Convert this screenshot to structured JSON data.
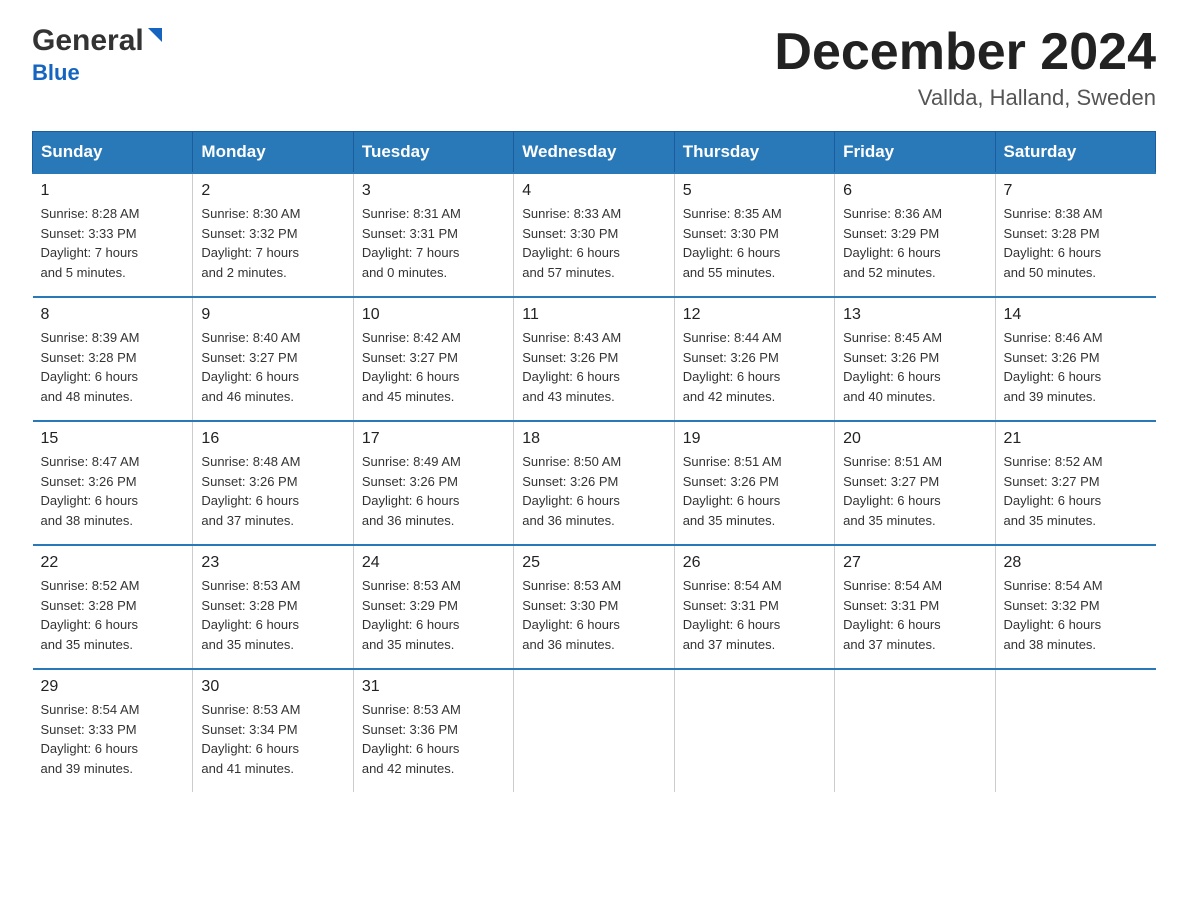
{
  "header": {
    "logo_general": "General",
    "logo_blue": "Blue",
    "month": "December 2024",
    "location": "Vallda, Halland, Sweden"
  },
  "days_of_week": [
    "Sunday",
    "Monday",
    "Tuesday",
    "Wednesday",
    "Thursday",
    "Friday",
    "Saturday"
  ],
  "weeks": [
    [
      {
        "num": "1",
        "sunrise": "8:28 AM",
        "sunset": "3:33 PM",
        "daylight_hours": "7",
        "daylight_minutes": "5"
      },
      {
        "num": "2",
        "sunrise": "8:30 AM",
        "sunset": "3:32 PM",
        "daylight_hours": "7",
        "daylight_minutes": "2"
      },
      {
        "num": "3",
        "sunrise": "8:31 AM",
        "sunset": "3:31 PM",
        "daylight_hours": "7",
        "daylight_minutes": "0"
      },
      {
        "num": "4",
        "sunrise": "8:33 AM",
        "sunset": "3:30 PM",
        "daylight_hours": "6",
        "daylight_minutes": "57"
      },
      {
        "num": "5",
        "sunrise": "8:35 AM",
        "sunset": "3:30 PM",
        "daylight_hours": "6",
        "daylight_minutes": "55"
      },
      {
        "num": "6",
        "sunrise": "8:36 AM",
        "sunset": "3:29 PM",
        "daylight_hours": "6",
        "daylight_minutes": "52"
      },
      {
        "num": "7",
        "sunrise": "8:38 AM",
        "sunset": "3:28 PM",
        "daylight_hours": "6",
        "daylight_minutes": "50"
      }
    ],
    [
      {
        "num": "8",
        "sunrise": "8:39 AM",
        "sunset": "3:28 PM",
        "daylight_hours": "6",
        "daylight_minutes": "48"
      },
      {
        "num": "9",
        "sunrise": "8:40 AM",
        "sunset": "3:27 PM",
        "daylight_hours": "6",
        "daylight_minutes": "46"
      },
      {
        "num": "10",
        "sunrise": "8:42 AM",
        "sunset": "3:27 PM",
        "daylight_hours": "6",
        "daylight_minutes": "45"
      },
      {
        "num": "11",
        "sunrise": "8:43 AM",
        "sunset": "3:26 PM",
        "daylight_hours": "6",
        "daylight_minutes": "43"
      },
      {
        "num": "12",
        "sunrise": "8:44 AM",
        "sunset": "3:26 PM",
        "daylight_hours": "6",
        "daylight_minutes": "42"
      },
      {
        "num": "13",
        "sunrise": "8:45 AM",
        "sunset": "3:26 PM",
        "daylight_hours": "6",
        "daylight_minutes": "40"
      },
      {
        "num": "14",
        "sunrise": "8:46 AM",
        "sunset": "3:26 PM",
        "daylight_hours": "6",
        "daylight_minutes": "39"
      }
    ],
    [
      {
        "num": "15",
        "sunrise": "8:47 AM",
        "sunset": "3:26 PM",
        "daylight_hours": "6",
        "daylight_minutes": "38"
      },
      {
        "num": "16",
        "sunrise": "8:48 AM",
        "sunset": "3:26 PM",
        "daylight_hours": "6",
        "daylight_minutes": "37"
      },
      {
        "num": "17",
        "sunrise": "8:49 AM",
        "sunset": "3:26 PM",
        "daylight_hours": "6",
        "daylight_minutes": "36"
      },
      {
        "num": "18",
        "sunrise": "8:50 AM",
        "sunset": "3:26 PM",
        "daylight_hours": "6",
        "daylight_minutes": "36"
      },
      {
        "num": "19",
        "sunrise": "8:51 AM",
        "sunset": "3:26 PM",
        "daylight_hours": "6",
        "daylight_minutes": "35"
      },
      {
        "num": "20",
        "sunrise": "8:51 AM",
        "sunset": "3:27 PM",
        "daylight_hours": "6",
        "daylight_minutes": "35"
      },
      {
        "num": "21",
        "sunrise": "8:52 AM",
        "sunset": "3:27 PM",
        "daylight_hours": "6",
        "daylight_minutes": "35"
      }
    ],
    [
      {
        "num": "22",
        "sunrise": "8:52 AM",
        "sunset": "3:28 PM",
        "daylight_hours": "6",
        "daylight_minutes": "35"
      },
      {
        "num": "23",
        "sunrise": "8:53 AM",
        "sunset": "3:28 PM",
        "daylight_hours": "6",
        "daylight_minutes": "35"
      },
      {
        "num": "24",
        "sunrise": "8:53 AM",
        "sunset": "3:29 PM",
        "daylight_hours": "6",
        "daylight_minutes": "35"
      },
      {
        "num": "25",
        "sunrise": "8:53 AM",
        "sunset": "3:30 PM",
        "daylight_hours": "6",
        "daylight_minutes": "36"
      },
      {
        "num": "26",
        "sunrise": "8:54 AM",
        "sunset": "3:31 PM",
        "daylight_hours": "6",
        "daylight_minutes": "37"
      },
      {
        "num": "27",
        "sunrise": "8:54 AM",
        "sunset": "3:31 PM",
        "daylight_hours": "6",
        "daylight_minutes": "37"
      },
      {
        "num": "28",
        "sunrise": "8:54 AM",
        "sunset": "3:32 PM",
        "daylight_hours": "6",
        "daylight_minutes": "38"
      }
    ],
    [
      {
        "num": "29",
        "sunrise": "8:54 AM",
        "sunset": "3:33 PM",
        "daylight_hours": "6",
        "daylight_minutes": "39"
      },
      {
        "num": "30",
        "sunrise": "8:53 AM",
        "sunset": "3:34 PM",
        "daylight_hours": "6",
        "daylight_minutes": "41"
      },
      {
        "num": "31",
        "sunrise": "8:53 AM",
        "sunset": "3:36 PM",
        "daylight_hours": "6",
        "daylight_minutes": "42"
      },
      null,
      null,
      null,
      null
    ]
  ],
  "labels": {
    "sunrise": "Sunrise:",
    "sunset": "Sunset:",
    "daylight": "Daylight:",
    "hours_suffix": "hours",
    "and": "and",
    "minutes_suffix": "minutes."
  }
}
